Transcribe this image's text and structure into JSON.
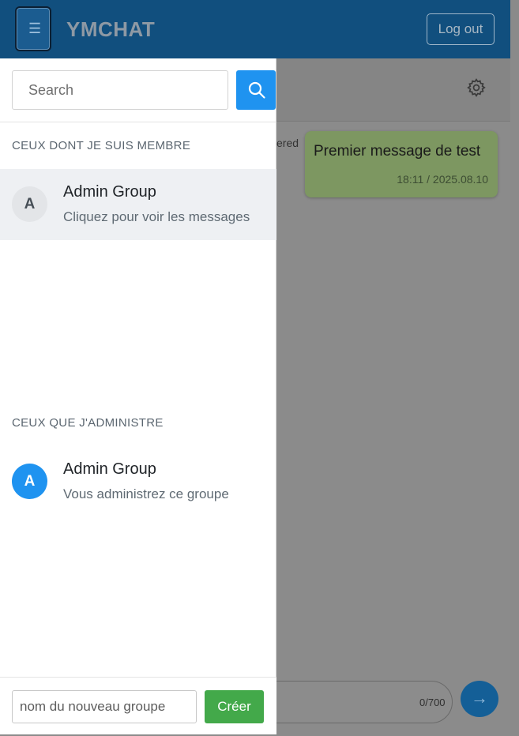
{
  "navbar": {
    "menu_icon": "hamburger-menu-icon",
    "brand": "YMCHAT",
    "logout_label": "Log out"
  },
  "chat": {
    "settings_icon": "gear-icon",
    "delivered_fragment": "vered",
    "message_text": "Premier message de test",
    "message_time": "18:11 / 2025.08.10",
    "char_counter": "0/700",
    "send_icon": "arrow-right-icon"
  },
  "drawer": {
    "search_placeholder": "Search",
    "search_icon": "search-icon",
    "member_section_title": "CEUX DONT JE SUIS MEMBRE",
    "member_groups": [
      {
        "avatar": "A",
        "name": "Admin Group",
        "subtitle": "Cliquez pour voir les messages"
      }
    ],
    "admin_section_title": "CEUX QUE J'ADMINISTRE",
    "admin_groups": [
      {
        "avatar": "A",
        "name": "Admin Group",
        "subtitle": "Vous administrez ce groupe"
      }
    ],
    "new_group_placeholder": "nom du nouveau groupe",
    "create_label": "Créer"
  },
  "colors": {
    "navbar": "#114f7e",
    "accent_blue": "#1f93f0",
    "create_green": "#43a94a",
    "active_item_bg": "#eef0f3"
  }
}
